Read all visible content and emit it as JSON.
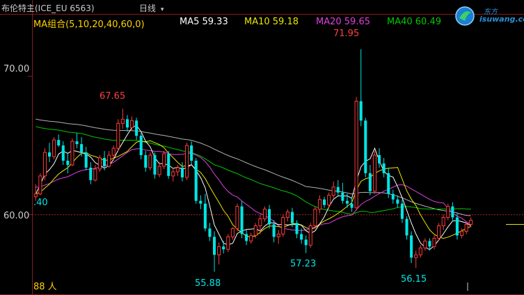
{
  "header": {
    "title": "布伦特主(ICE_EU 6563)",
    "period": "日线",
    "period_icon": "dropdown-arrow-icon"
  },
  "ma_legend": {
    "group": "MA组合(5,10,20,40,60,0)",
    "ma5": "MA5 59.33",
    "ma10": "MA10 59.18",
    "ma20": "MA20 59.65",
    "ma40": "MA40 60.49"
  },
  "colors": {
    "up": "#ff3b3b",
    "down": "#00e5e5",
    "ma_group": "#ffd200",
    "ma5": "#ffffff",
    "ma10": "#e8e800",
    "ma20": "#e040e0",
    "ma40": "#00c800",
    "ma60": "#b0b0b0"
  },
  "logo": {
    "text": "isuwang.com",
    "icon": "isuwang-logo-icon"
  },
  "labels": {
    "axis_70": "70.00",
    "axis_60": "60.00",
    "left_price": ".40",
    "high_main": "71.95",
    "high_left": "67.65",
    "low_1": "55.88",
    "low_2": "57.23",
    "low_3": "56.15",
    "bottom_left": "88 人"
  },
  "chart_data": {
    "type": "candlestick",
    "ylim": [
      54.5,
      73.5
    ],
    "y_ticks": [
      60,
      70
    ],
    "candles": [
      [
        61.3,
        62.2,
        61.0,
        61.5
      ],
      [
        61.5,
        63.0,
        61.4,
        62.8
      ],
      [
        62.8,
        64.8,
        62.5,
        64.5
      ],
      [
        64.5,
        65.2,
        63.8,
        64.2
      ],
      [
        64.2,
        65.6,
        64.0,
        65.4
      ],
      [
        65.4,
        65.8,
        64.9,
        65.0
      ],
      [
        65.0,
        65.3,
        63.6,
        63.9
      ],
      [
        63.9,
        64.5,
        63.0,
        63.6
      ],
      [
        63.6,
        65.5,
        63.5,
        65.3
      ],
      [
        65.3,
        65.9,
        64.8,
        65.1
      ],
      [
        65.1,
        65.6,
        64.2,
        64.5
      ],
      [
        64.5,
        64.9,
        63.2,
        63.4
      ],
      [
        63.4,
        63.8,
        62.2,
        62.5
      ],
      [
        62.5,
        63.6,
        62.4,
        63.3
      ],
      [
        63.3,
        64.3,
        63.1,
        64.1
      ],
      [
        64.1,
        64.6,
        63.2,
        63.5
      ],
      [
        63.5,
        64.6,
        63.4,
        64.3
      ],
      [
        64.3,
        65.0,
        63.9,
        64.8
      ],
      [
        64.8,
        66.9,
        64.6,
        66.6
      ],
      [
        66.6,
        67.65,
        66.2,
        66.9
      ],
      [
        66.9,
        67.2,
        66.0,
        66.3
      ],
      [
        66.3,
        67.1,
        66.1,
        66.8
      ],
      [
        66.8,
        67.0,
        65.4,
        65.7
      ],
      [
        65.7,
        65.9,
        64.0,
        64.3
      ],
      [
        64.3,
        64.6,
        63.1,
        63.4
      ],
      [
        63.4,
        64.5,
        63.2,
        64.3
      ],
      [
        64.3,
        64.5,
        62.6,
        62.9
      ],
      [
        62.9,
        63.8,
        62.7,
        63.5
      ],
      [
        63.5,
        64.6,
        63.3,
        64.4
      ],
      [
        64.4,
        64.6,
        62.6,
        62.8
      ],
      [
        62.8,
        63.3,
        62.4,
        63.1
      ],
      [
        63.1,
        63.6,
        62.8,
        63.4
      ],
      [
        63.4,
        63.8,
        62.4,
        62.7
      ],
      [
        62.7,
        65.2,
        62.5,
        65.0
      ],
      [
        65.0,
        65.3,
        63.6,
        63.9
      ],
      [
        63.9,
        64.1,
        60.8,
        61.0
      ],
      [
        61.0,
        61.4,
        60.4,
        60.8
      ],
      [
        60.8,
        61.5,
        58.8,
        59.0
      ],
      [
        59.0,
        59.4,
        58.1,
        58.4
      ],
      [
        58.4,
        58.8,
        55.88,
        57.1
      ],
      [
        57.1,
        58.0,
        56.4,
        57.7
      ],
      [
        57.7,
        58.1,
        57.2,
        57.5
      ],
      [
        57.5,
        58.6,
        57.3,
        58.4
      ],
      [
        58.4,
        59.1,
        58.2,
        59.0
      ],
      [
        59.0,
        60.8,
        58.8,
        60.6
      ],
      [
        60.6,
        61.0,
        58.3,
        58.6
      ],
      [
        58.6,
        58.9,
        57.8,
        58.1
      ],
      [
        58.1,
        58.7,
        57.9,
        58.5
      ],
      [
        58.5,
        59.4,
        58.3,
        59.2
      ],
      [
        59.2,
        60.0,
        58.6,
        59.7
      ],
      [
        59.7,
        60.6,
        59.5,
        60.4
      ],
      [
        60.4,
        60.7,
        59.0,
        59.3
      ],
      [
        59.3,
        59.6,
        58.0,
        58.4
      ],
      [
        58.4,
        58.9,
        57.9,
        58.6
      ],
      [
        58.6,
        60.0,
        58.4,
        59.8
      ],
      [
        59.8,
        60.4,
        59.5,
        60.2
      ],
      [
        60.2,
        60.5,
        59.1,
        59.4
      ],
      [
        59.4,
        59.6,
        58.3,
        58.6
      ],
      [
        58.6,
        59.0,
        57.9,
        58.2
      ],
      [
        58.2,
        58.5,
        57.23,
        57.8
      ],
      [
        57.8,
        59.4,
        57.6,
        59.2
      ],
      [
        59.2,
        60.6,
        59.0,
        60.4
      ],
      [
        60.4,
        61.4,
        60.1,
        61.1
      ],
      [
        61.1,
        61.3,
        60.5,
        60.7
      ],
      [
        60.7,
        61.6,
        60.5,
        61.4
      ],
      [
        61.4,
        62.4,
        61.2,
        62.0
      ],
      [
        62.0,
        62.5,
        61.3,
        61.6
      ],
      [
        61.6,
        62.3,
        60.8,
        61.0
      ],
      [
        61.0,
        61.5,
        60.5,
        60.8
      ],
      [
        60.8,
        61.3,
        60.2,
        60.5
      ],
      [
        60.5,
        68.5,
        60.3,
        68.2
      ],
      [
        68.2,
        71.95,
        66.4,
        66.8
      ],
      [
        66.8,
        67.0,
        62.7,
        63.0
      ],
      [
        63.0,
        63.6,
        61.4,
        61.7
      ],
      [
        61.7,
        64.6,
        61.5,
        64.3
      ],
      [
        64.3,
        64.8,
        63.4,
        63.7
      ],
      [
        63.7,
        64.1,
        62.7,
        63.0
      ],
      [
        63.0,
        63.4,
        61.2,
        61.5
      ],
      [
        61.5,
        61.8,
        60.8,
        61.1
      ],
      [
        61.1,
        61.4,
        60.5,
        60.8
      ],
      [
        60.8,
        61.1,
        59.4,
        59.7
      ],
      [
        59.7,
        59.9,
        58.2,
        58.5
      ],
      [
        58.5,
        58.8,
        56.5,
        56.9
      ],
      [
        56.9,
        57.4,
        56.15,
        57.1
      ],
      [
        57.1,
        57.8,
        56.9,
        57.6
      ],
      [
        57.6,
        58.3,
        57.4,
        58.1
      ],
      [
        58.1,
        58.3,
        57.4,
        57.7
      ],
      [
        57.7,
        58.5,
        57.5,
        58.3
      ],
      [
        58.3,
        59.4,
        58.1,
        59.2
      ],
      [
        59.2,
        60.0,
        58.9,
        59.8
      ],
      [
        59.8,
        60.8,
        59.6,
        60.6
      ],
      [
        60.6,
        60.9,
        59.5,
        59.8
      ],
      [
        59.8,
        60.1,
        58.2,
        58.5
      ],
      [
        58.5,
        59.0,
        58.3,
        58.8
      ],
      [
        58.8,
        59.5,
        58.6,
        59.3
      ],
      [
        59.3,
        59.8,
        59.1,
        59.6
      ]
    ]
  }
}
